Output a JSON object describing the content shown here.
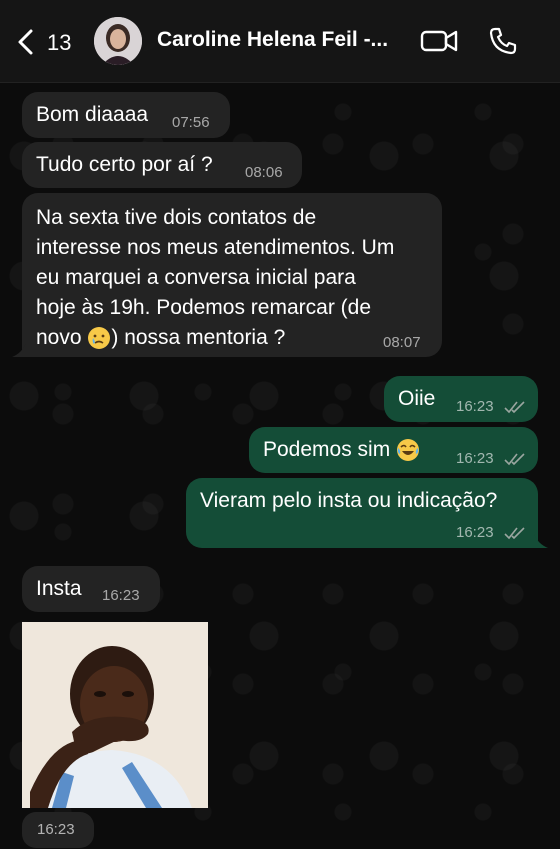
{
  "header": {
    "back_count": "13",
    "contact_name": "Caroline Helena Feil -..."
  },
  "messages": [
    {
      "text": "Bom diaaaa",
      "time": "07:56"
    },
    {
      "text": "Tudo certo por aí ?",
      "time": "08:06"
    },
    {
      "line1": "Na sexta tive dois contatos de",
      "line2": "interesse nos meus atendimentos. Um",
      "line3": "eu marquei a conversa inicial para",
      "line4": "hoje às 19h. Podemos remarcar (de",
      "line5a": "novo ",
      "line5b": ") nossa mentoria ?",
      "time": "08:07"
    },
    {
      "text": "Oiie",
      "time": "16:23"
    },
    {
      "text": "Podemos sim ",
      "time": "16:23"
    },
    {
      "text": "Vieram pelo insta ou indicação?",
      "time": "16:23"
    },
    {
      "text": "Insta",
      "time": "16:23"
    },
    {
      "image": "meme-photo",
      "time": "16:23"
    }
  ],
  "colors": {
    "incoming_bubble": "#232323",
    "outgoing_bubble": "#144d37",
    "read_ticks": "#9aa6a0"
  }
}
